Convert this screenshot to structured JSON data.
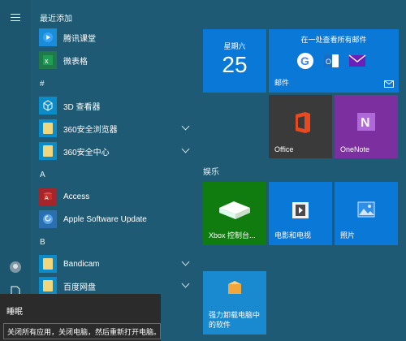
{
  "app_list": {
    "section_recent": "最近添加",
    "recent": [
      {
        "label": "腾讯课堂",
        "icon": "tencent-classroom-icon"
      },
      {
        "label": "微表格",
        "icon": "excel-icon"
      }
    ],
    "section_hash": "#",
    "hash_items": [
      {
        "label": "3D 查看器",
        "icon": "3d-cube-icon"
      },
      {
        "label": "360安全浏览器",
        "icon": "folder-icon"
      },
      {
        "label": "360安全中心",
        "icon": "folder-icon"
      }
    ],
    "section_a": "A",
    "a_items": [
      {
        "label": "Access",
        "icon": "access-icon"
      },
      {
        "label": "Apple Software Update",
        "icon": "apple-update-icon"
      }
    ],
    "section_b": "B",
    "b_items": [
      {
        "label": "Bandicam",
        "icon": "folder-icon"
      },
      {
        "label": "百度网盘",
        "icon": "folder-icon"
      }
    ]
  },
  "tiles": {
    "calendar": {
      "weekday": "星期六",
      "day": "25"
    },
    "mail": {
      "header": "在一处查看所有邮件",
      "label": "邮件"
    },
    "office": {
      "label": "Office"
    },
    "onenote": {
      "label": "OneNote"
    },
    "group_entertainment": "娱乐",
    "xbox": {
      "label": "Xbox 控制台..."
    },
    "movies": {
      "label": "电影和电视"
    },
    "photos": {
      "label": "照片"
    },
    "uninstaller": {
      "label": "强力卸载电脑中的软件"
    }
  },
  "context_menu": {
    "title": "睡眠",
    "description": "关闭所有应用，关闭电脑，然后重新打开电脑。"
  },
  "colors": {
    "background": "#1e5a73",
    "tile_blue": "#0a78d7",
    "office_dark": "#3a3a3a",
    "onenote_purple": "#7c2f9f",
    "xbox_green": "#107c10",
    "tooltip_bg": "#2b2b2b"
  }
}
